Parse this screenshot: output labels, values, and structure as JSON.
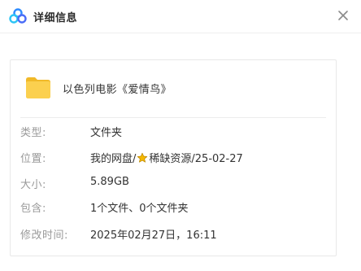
{
  "dialog": {
    "title": "详细信息",
    "logo_icon": "baidu-netdisk-cloud-icon",
    "close_icon": "close-icon"
  },
  "file": {
    "name": "以色列电影《爱情鸟》",
    "icon": "folder-icon"
  },
  "details": {
    "type_label": "类型:",
    "type_value": "文件夹",
    "location_label": "位置:",
    "location_prefix": "我的网盘/",
    "location_icon": "star-icon",
    "location_suffix": "稀缺资源/25-02-27",
    "size_label": "大小:",
    "size_value": "5.89GB",
    "contains_label": "包含:",
    "contains_value": "1个文件、0个文件夹",
    "modified_label": "修改时间:",
    "modified_value": "2025年02月27日，16:11"
  },
  "colors": {
    "folder": "#F7C948",
    "label": "#9a9a9a",
    "text": "#333333",
    "star": "#F5B800"
  }
}
